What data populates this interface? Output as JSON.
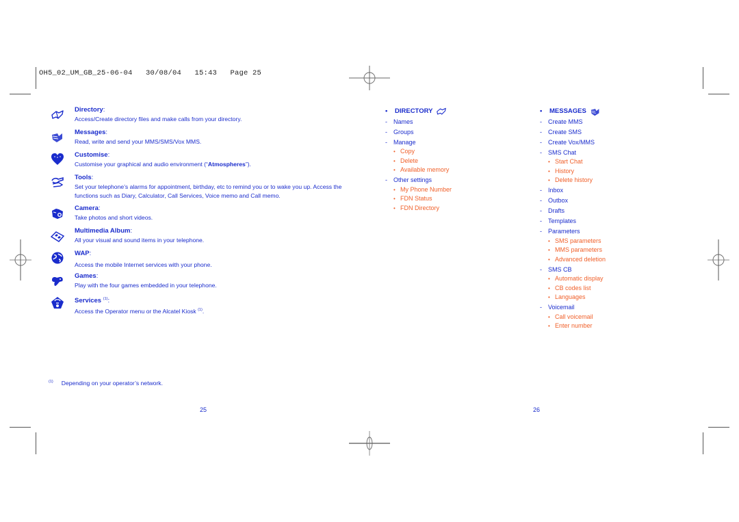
{
  "slug": "OH5_02_UM_GB_25-06-04   30/08/04   15:43   Page 25",
  "left_page": {
    "entries": [
      {
        "icon": "phonebook-icon",
        "title": "Directory",
        "desc": "Access/Create directory files and make calls from your directory."
      },
      {
        "icon": "messages-icon",
        "title": "Messages",
        "desc": "Read, write and send your MMS/SMS/Vox MMS."
      },
      {
        "icon": "heart-icon",
        "title": "Customise",
        "desc_pre": "Customise your graphical and audio environment (“",
        "desc_bold": "Atmospheres",
        "desc_post": "”)."
      },
      {
        "icon": "tools-icon",
        "title": "Tools",
        "desc": "Set your telephone’s alarms for appointment, birthday, etc to remind you or to wake you up. Access the functions such as Diary, Calculator, Call Services, Voice memo and Call memo."
      },
      {
        "icon": "camera-icon",
        "title": "Camera",
        "desc": "Take photos and short videos."
      },
      {
        "icon": "album-icon",
        "title": "Multimedia Album",
        "desc": "All your visual and sound items in your telephone."
      },
      {
        "icon": "globe-icon",
        "title": "WAP",
        "desc": "Access the mobile Internet services with your phone."
      },
      {
        "icon": "gamepad-icon",
        "title": "Games",
        "desc": "Play with the four games embedded in your telephone."
      },
      {
        "icon": "services-icon",
        "title": "Services",
        "title_sup": "(1)",
        "desc": "Access the Operator menu or the Alcatel Kiosk",
        "desc_sup": "(1)",
        "desc_end": "."
      }
    ],
    "footnote_mark": "(1)",
    "footnote": "Depending on your operator’s network.",
    "page_number": "25"
  },
  "right_page": {
    "directory": {
      "heading": "DIRECTORY",
      "icon": "phonebook-icon",
      "items": [
        {
          "label": "Names",
          "sub": []
        },
        {
          "label": "Groups",
          "sub": []
        },
        {
          "label": "Manage",
          "sub": [
            "Copy",
            "Delete",
            "Available memory"
          ]
        },
        {
          "label": "Other settings",
          "sub": [
            "My Phone Number",
            "FDN Status",
            "FDN Directory"
          ]
        }
      ]
    },
    "messages": {
      "heading": "MESSAGES",
      "icon": "messages-icon",
      "items": [
        {
          "label": "Create MMS",
          "sub": []
        },
        {
          "label": "Create SMS",
          "sub": []
        },
        {
          "label": "Create Vox/MMS",
          "sub": []
        },
        {
          "label": "SMS Chat",
          "sub": [
            "Start Chat",
            "History",
            "Delete history"
          ]
        },
        {
          "label": "Inbox",
          "sub": []
        },
        {
          "label": "Outbox",
          "sub": []
        },
        {
          "label": "Drafts",
          "sub": []
        },
        {
          "label": "Templates",
          "sub": []
        },
        {
          "label": "Parameters",
          "sub": [
            "SMS parameters",
            "MMS parameters",
            "Advanced deletion"
          ]
        },
        {
          "label": "SMS CB",
          "sub": [
            "Automatic display",
            "CB codes list",
            "Languages"
          ]
        },
        {
          "label": "Voicemail",
          "sub": [
            "Call voicemail",
            "Enter number"
          ]
        }
      ]
    },
    "page_number": "26"
  },
  "colors": {
    "primary_text": "#1a2ccc",
    "sub_item_text": "#f0602a",
    "marks": "#555555"
  }
}
